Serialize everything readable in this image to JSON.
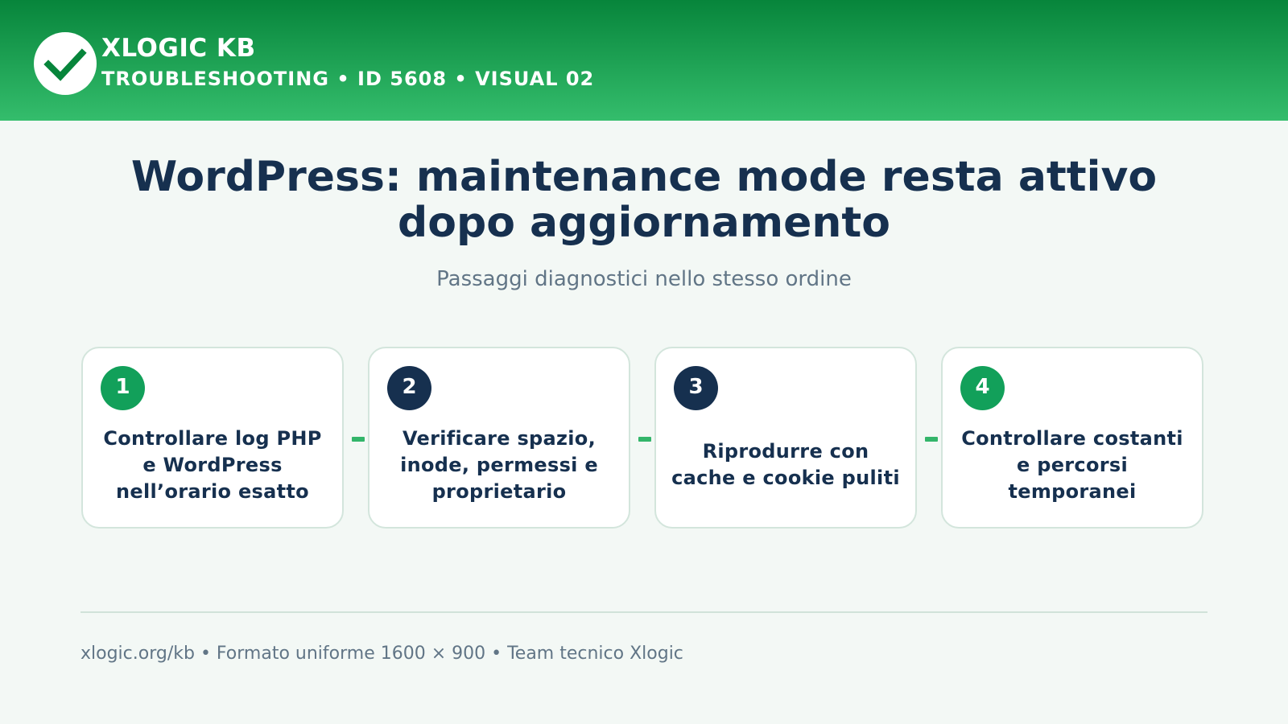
{
  "header": {
    "brand": "XLOGIC KB",
    "meta": "TROUBLESHOOTING • ID 5608 • VISUAL 02",
    "logo_icon": "checkmark-icon"
  },
  "title": {
    "line1": "WordPress: maintenance mode resta attivo",
    "line2": "dopo aggiornamento"
  },
  "lead": "Passaggi diagnostici nello stesso ordine",
  "steps": [
    {
      "number": "1",
      "text": "Controllare log PHP e WordPress nell’orario esatto",
      "badge_color": "#12a05a"
    },
    {
      "number": "2",
      "text": "Verificare spazio, inode, permessi e proprietario",
      "badge_color": "#16304f"
    },
    {
      "number": "3",
      "text": "Riprodurre con cache e cookie puliti",
      "badge_color": "#16304f"
    },
    {
      "number": "4",
      "text": "Controllare costanti e percorsi temporanei",
      "badge_color": "#12a05a"
    }
  ],
  "footer": "xlogic.org/kb • Formato uniforme 1600 × 900 • Team tecnico Xlogic",
  "colors": {
    "header_dark": "#07853b",
    "header_light": "#34bd6c",
    "title": "#16304f",
    "accent_green": "#12a05a",
    "connector": "#33b56a"
  }
}
